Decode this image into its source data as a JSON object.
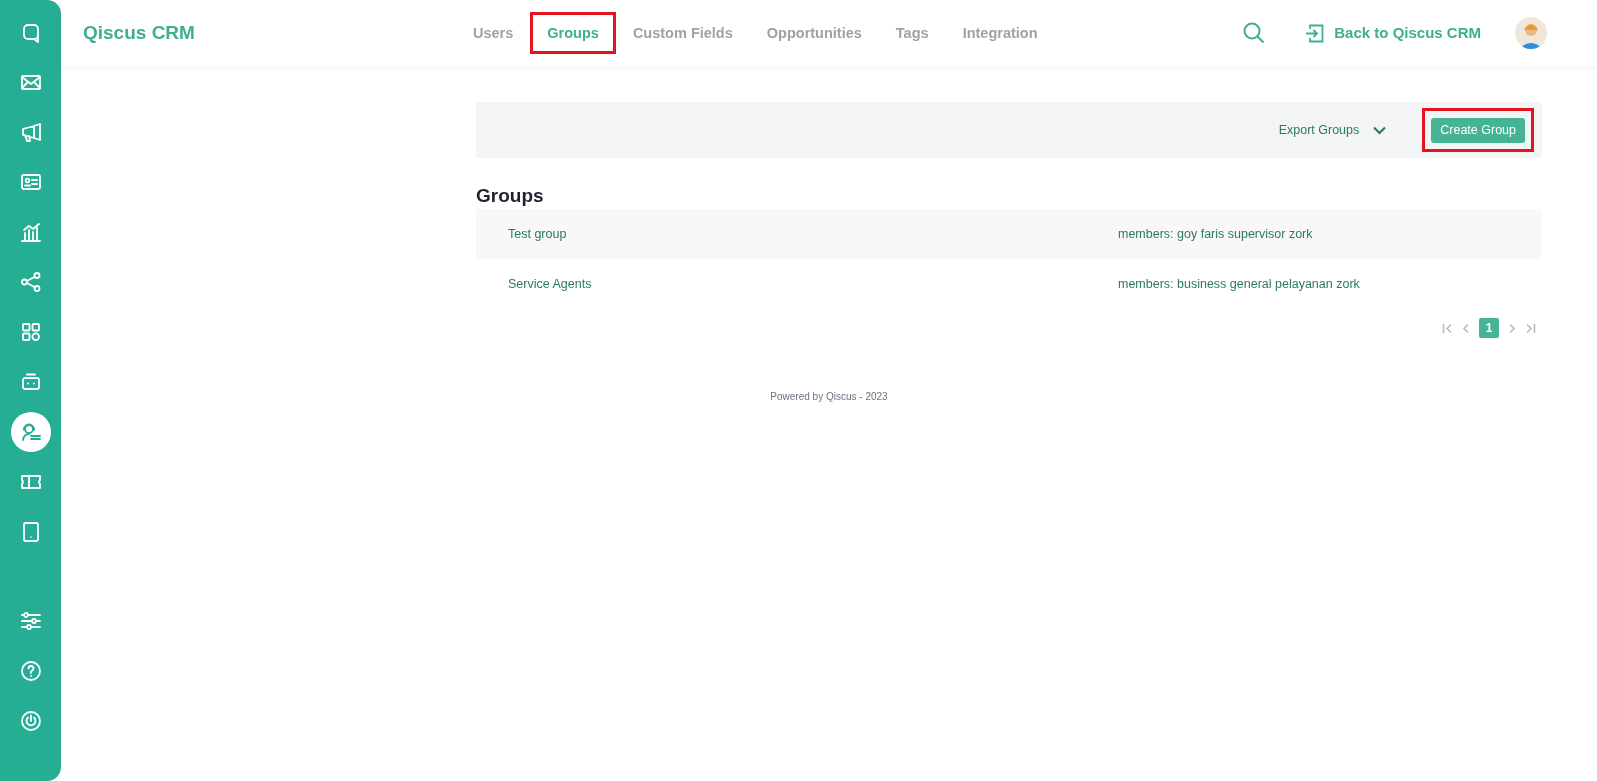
{
  "sidebar": {
    "items": [
      {
        "kind": "chat",
        "selected": false
      },
      {
        "kind": "mail",
        "selected": false
      },
      {
        "kind": "megaphone",
        "selected": false
      },
      {
        "kind": "contact",
        "selected": false
      },
      {
        "kind": "chart",
        "selected": false
      },
      {
        "kind": "share",
        "selected": false
      },
      {
        "kind": "apps",
        "selected": false
      },
      {
        "kind": "bot",
        "selected": false
      },
      {
        "kind": "agent",
        "selected": true
      },
      {
        "kind": "ticket",
        "selected": false
      },
      {
        "kind": "tablet",
        "selected": false
      }
    ],
    "bottom_items": [
      {
        "kind": "settings"
      },
      {
        "kind": "help"
      },
      {
        "kind": "power"
      }
    ]
  },
  "header": {
    "logo": "Qiscus CRM",
    "tabs": [
      {
        "label": "Users",
        "selected": false,
        "highlighted": false
      },
      {
        "label": "Groups",
        "selected": true,
        "highlighted": true
      },
      {
        "label": "Custom Fields",
        "selected": false,
        "highlighted": false
      },
      {
        "label": "Opportunities",
        "selected": false,
        "highlighted": false
      },
      {
        "label": "Tags",
        "selected": false,
        "highlighted": false
      },
      {
        "label": "Integration",
        "selected": false,
        "highlighted": false
      }
    ],
    "back_link": "Back to Qiscus CRM"
  },
  "toolbar": {
    "export": "Export Groups",
    "create_button": {
      "label": "Create Group",
      "highlighted": true
    }
  },
  "groups": {
    "title": "Groups",
    "rows": [
      {
        "name": "Test group",
        "members": "members: goy faris supervisor zork"
      },
      {
        "name": "Service Agents",
        "members": "members: business general pelayanan zork"
      }
    ]
  },
  "pagination": {
    "pages": [
      {
        "label": "1",
        "selected": true
      }
    ]
  },
  "footer": "Powered by Qiscus - 2023"
}
